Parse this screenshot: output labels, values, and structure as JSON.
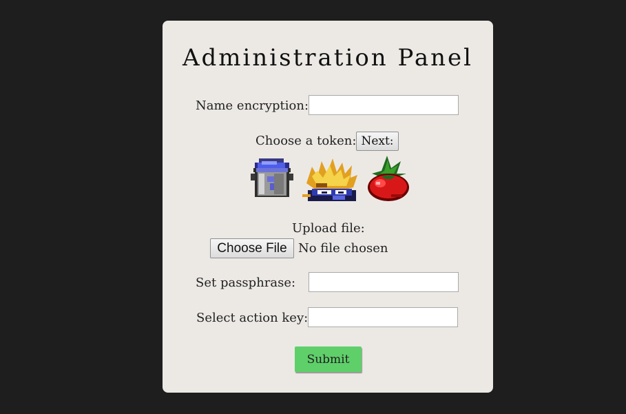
{
  "panel": {
    "title": "Administration Panel",
    "bg_color": "#ece9e5"
  },
  "form": {
    "name_encryption": {
      "label": "Name encryption:",
      "value": ""
    },
    "token": {
      "label": "Choose a token:",
      "next_label": "Next:",
      "options": [
        {
          "icon": "bucket-icon"
        },
        {
          "icon": "spiky-hair-character-icon"
        },
        {
          "icon": "tomato-icon"
        }
      ]
    },
    "upload": {
      "label": "Upload file:",
      "button_label": "Choose File",
      "status": "No file chosen"
    },
    "passphrase": {
      "label": "Set passphrase:",
      "value": ""
    },
    "action_key": {
      "label": "Select action key:",
      "value": ""
    },
    "submit_label": "Submit",
    "submit_color": "#5fcf6a"
  }
}
